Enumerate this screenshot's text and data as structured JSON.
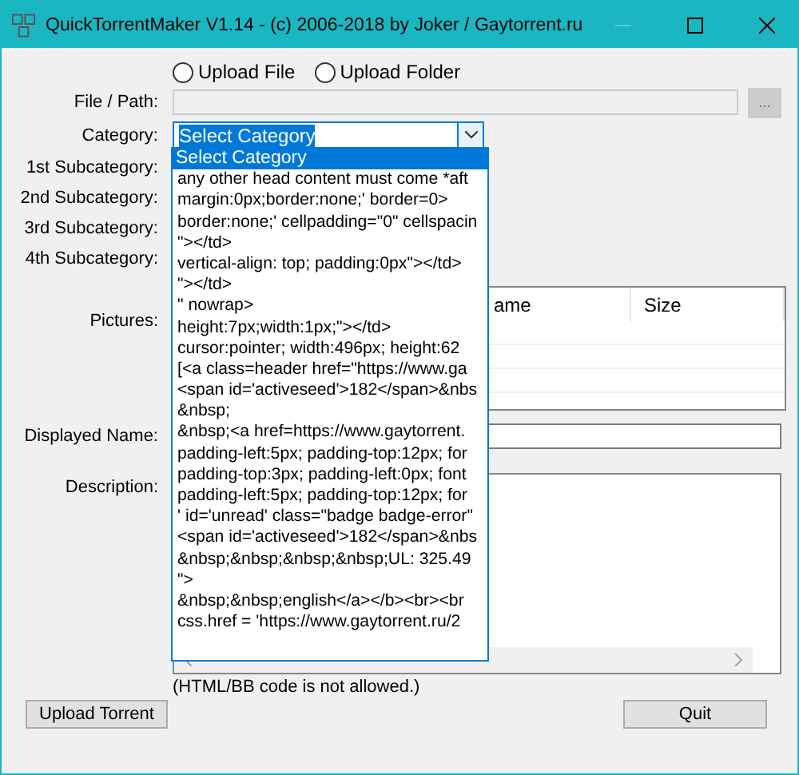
{
  "window": {
    "title": "QuickTorrentMaker V1.14 - (c) 2006-2018 by Joker / Gaytorrent.ru"
  },
  "source_options": [
    {
      "label": "Upload File",
      "selected": false
    },
    {
      "label": "Upload Folder",
      "selected": false
    }
  ],
  "file_path": {
    "label": "File / Path:",
    "disabled": true,
    "browse": "..."
  },
  "category": {
    "label": "Category:",
    "value": "Select Category",
    "expanded": true,
    "options": [
      {
        "label": "Select Category",
        "selected": true
      },
      {
        "label": "any other head content must come *aft",
        "selected": false
      },
      {
        "label": "margin:0px;border:none;' border=0>",
        "selected": false
      },
      {
        "label": "border:none;' cellpadding=\"0\" cellspacin",
        "selected": false
      },
      {
        "label": "\"></td>",
        "selected": false
      },
      {
        "label": "vertical-align: top; padding:0px\"></td>",
        "selected": false
      },
      {
        "label": "\"></td>",
        "selected": false
      },
      {
        "label": "\" nowrap>",
        "selected": false
      },
      {
        "label": "height:7px;width:1px;\"></td>",
        "selected": false
      },
      {
        "label": "cursor:pointer; width:496px; height:62",
        "selected": false
      },
      {
        "label": "[<a class=header href=\"https://www.ga",
        "selected": false
      },
      {
        "label": "<span id='activeseed'>182</span>&nbs",
        "selected": false
      },
      {
        "label": "&nbsp;",
        "selected": false
      },
      {
        "label": "&nbsp;<a href=https://www.gaytorrent.",
        "selected": false
      },
      {
        "label": "padding-left:5px; padding-top:12px; for",
        "selected": false
      },
      {
        "label": "padding-top:3px; padding-left:0px; font",
        "selected": false
      },
      {
        "label": "padding-left:5px; padding-top:12px; for",
        "selected": false
      },
      {
        "label": "' id='unread' class=\"badge badge-error\"",
        "selected": false
      },
      {
        "label": "<span id='activeseed'>182</span>&nbs",
        "selected": false
      },
      {
        "label": "&nbsp;&nbsp;&nbsp;&nbsp;UL: 325.49",
        "selected": false
      },
      {
        "label": "\">",
        "selected": false
      },
      {
        "label": "&nbsp;&nbsp;english</a></b><br><br",
        "selected": false
      },
      {
        "label": "css.href = 'https://www.gaytorrent.ru/2",
        "selected": false
      }
    ]
  },
  "subcategories": [
    {
      "label": "1st Subcategory:"
    },
    {
      "label": "2nd Subcategory:"
    },
    {
      "label": "3rd Subcategory:"
    },
    {
      "label": "4th Subcategory:"
    }
  ],
  "pictures": {
    "label": "Pictures:",
    "columns": [
      "ame",
      "Size"
    ]
  },
  "displayed_name": {
    "label": "Displayed Name:"
  },
  "description": {
    "label": "Description:",
    "note": "(HTML/BB code is not allowed.)"
  },
  "buttons": [
    {
      "label": "Upload Torrent"
    },
    {
      "label": "Quit"
    }
  ]
}
